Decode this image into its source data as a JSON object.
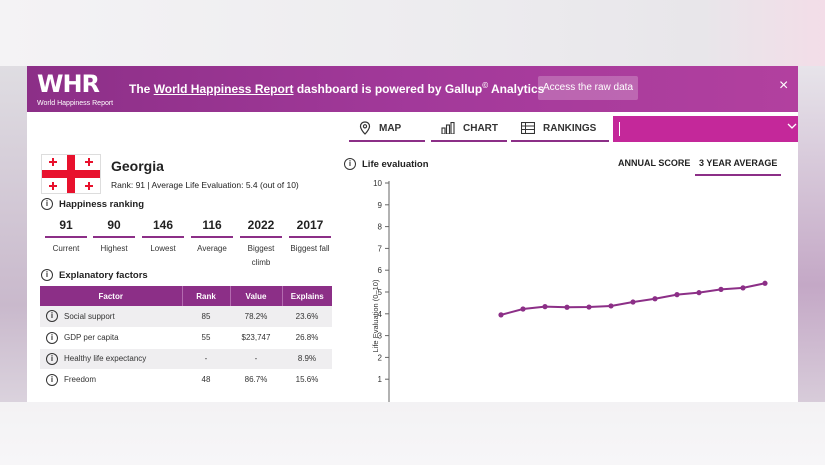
{
  "banner": {
    "logo_mark": "WHR",
    "logo_sub": "World Happiness Report",
    "text_prefix": "The",
    "link_text": "World Happiness Report",
    "text_suffix": "dashboard is powered by Gallup",
    "superscript": "©",
    "text_end": "Analytics",
    "raw_data_button": "Access the raw data",
    "close_label": "×"
  },
  "nav": {
    "map_label": "MAP",
    "chart_label": "CHART",
    "rankings_label": "RANKINGS",
    "search_value": ""
  },
  "country": {
    "name": "Georgia",
    "subtitle": "Rank: 91 | Average Life Evaluation: 5.4 (out of 10)"
  },
  "happiness_ranking": {
    "title": "Happiness ranking",
    "items": [
      {
        "value": "91",
        "label": "Current"
      },
      {
        "value": "90",
        "label": "Highest"
      },
      {
        "value": "146",
        "label": "Lowest"
      },
      {
        "value": "116",
        "label": "Average"
      },
      {
        "value": "2022",
        "label": "Biggest climb"
      },
      {
        "value": "2017",
        "label": "Biggest fall"
      }
    ]
  },
  "explanatory_factors": {
    "title": "Explanatory factors",
    "headers": [
      "Factor",
      "Rank",
      "Value",
      "Explains"
    ],
    "rows": [
      {
        "factor": "Social support",
        "rank": "85",
        "value": "78.2%",
        "explains": "23.6%"
      },
      {
        "factor": "GDP per capita",
        "rank": "55",
        "value": "$23,747",
        "explains": "26.8%"
      },
      {
        "factor": "Healthy life expectancy",
        "rank": "-",
        "value": "-",
        "explains": "8.9%"
      },
      {
        "factor": "Freedom",
        "rank": "48",
        "value": "86.7%",
        "explains": "15.6%"
      }
    ]
  },
  "chart_panel": {
    "title": "Life evaluation",
    "tab_annual": "ANNUAL SCORE",
    "tab_3yr": "3 YEAR AVERAGE",
    "active_tab": "3 YEAR AVERAGE"
  },
  "colors": {
    "brand": "#8c2f87",
    "search": "#c4289a",
    "line": "#8c2f87"
  },
  "chart_data": {
    "type": "line",
    "ylabel": "Life Evaluation (0–10)",
    "ylim": [
      0,
      10
    ],
    "yticks": [
      1,
      2,
      3,
      4,
      5,
      6,
      7,
      8,
      9,
      10
    ],
    "series": [
      {
        "values": [
          3.95,
          4.22,
          4.33,
          4.3,
          4.31,
          4.36,
          4.54,
          4.69,
          4.88,
          4.97,
          5.12,
          5.19,
          5.4
        ]
      }
    ]
  }
}
